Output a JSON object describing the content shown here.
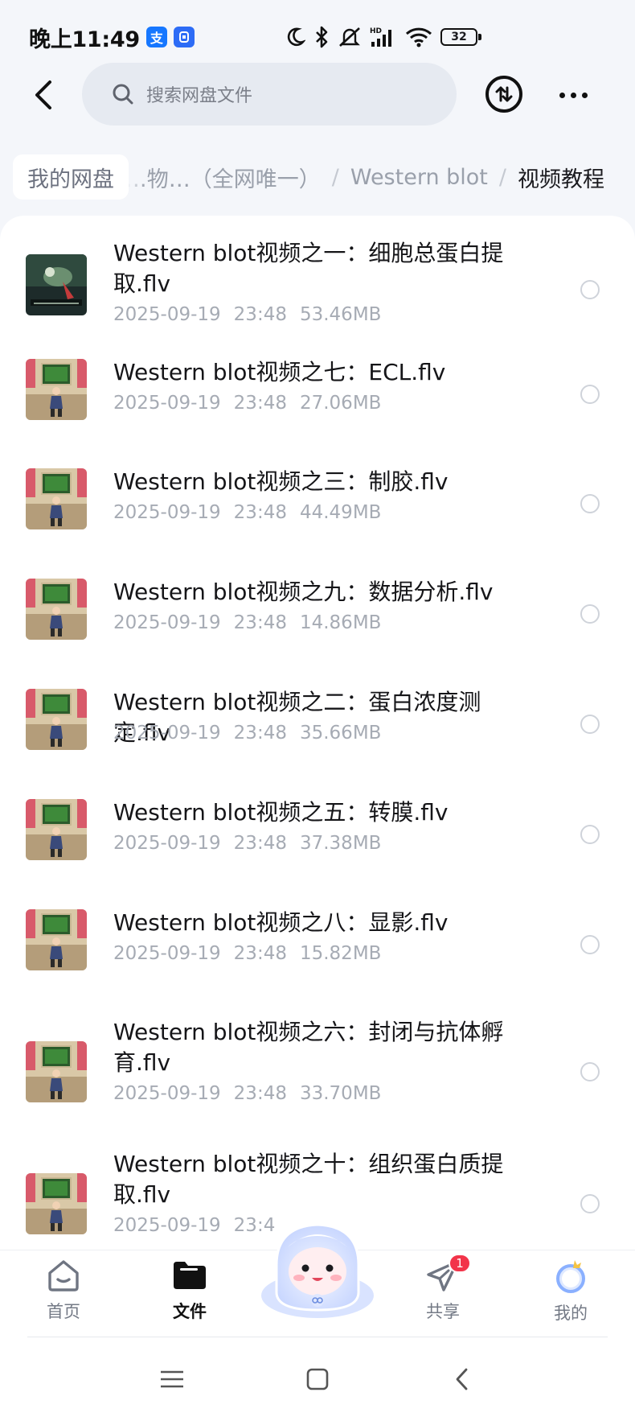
{
  "status_bar": {
    "time": "晚上11:49",
    "app_icon_1": "支",
    "app_icon_1_color": "#1677ff",
    "app_icon_2_color": "#2d6cf6",
    "battery": "32",
    "icons": [
      "moon-icon",
      "bluetooth-icon",
      "mute-icon",
      "hd-signal-icon",
      "wifi-icon",
      "battery-icon"
    ]
  },
  "header": {
    "search_placeholder": "搜索网盘文件"
  },
  "breadcrumb": {
    "root": "我的网盘",
    "items": [
      "…物…（全网唯一）",
      "Western blot",
      "视频教程"
    ]
  },
  "files": [
    {
      "name": "Western blot视频之一：细胞总蛋白提取.flv",
      "date": "2025-09-19",
      "time": "23:48",
      "size": "53.46MB",
      "thumb": "dark"
    },
    {
      "name": "Western blot视频之七：ECL.flv",
      "date": "2025-09-19",
      "time": "23:48",
      "size": "27.06MB",
      "thumb": "room"
    },
    {
      "name": "Western blot视频之三：制胶.flv",
      "date": "2025-09-19",
      "time": "23:48",
      "size": "44.49MB",
      "thumb": "room"
    },
    {
      "name": "Western blot视频之九：数据分析.flv",
      "date": "2025-09-19",
      "time": "23:48",
      "size": "14.86MB",
      "thumb": "room"
    },
    {
      "name": "Western blot视频之二：蛋白浓度测定.flv",
      "date": "2025-09-19",
      "time": "23:48",
      "size": "35.66MB",
      "thumb": "room"
    },
    {
      "name": "Western blot视频之五：转膜.flv",
      "date": "2025-09-19",
      "time": "23:48",
      "size": "37.38MB",
      "thumb": "room"
    },
    {
      "name": "Western blot视频之八：显影.flv",
      "date": "2025-09-19",
      "time": "23:48",
      "size": "15.82MB",
      "thumb": "room"
    },
    {
      "name": "Western blot视频之六：封闭与抗体孵育.flv",
      "date": "2025-09-19",
      "time": "23:48",
      "size": "33.70MB",
      "thumb": "room"
    },
    {
      "name": "Western blot视频之十：组织蛋白质提取.flv",
      "date": "2025-09-19",
      "time": "23:4",
      "size": "",
      "thumb": "room"
    }
  ],
  "bottom_nav": {
    "home": "首页",
    "files": "文件",
    "share": "共享",
    "share_badge": "1",
    "mine": "我的",
    "active": "files"
  },
  "colors": {
    "accent": "#111111",
    "badge": "#f2344a",
    "meta_text": "#a6abb4"
  }
}
